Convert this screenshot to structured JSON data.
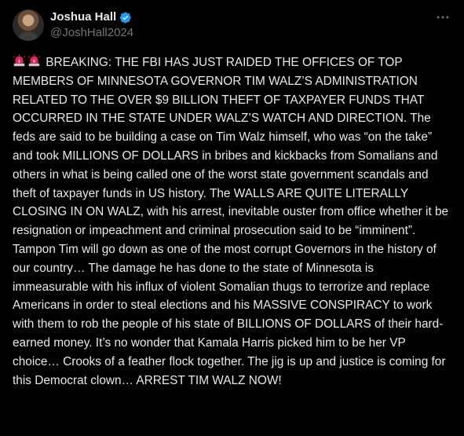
{
  "post": {
    "author": {
      "display_name": "Joshua Hall",
      "handle": "@JoshHall2024",
      "verified": true,
      "verified_color": "#1d9bf0"
    },
    "menu_icon": "more-horizontal-icon",
    "emoji_prefix": [
      "siren-emoji",
      "siren-emoji"
    ],
    "text": "BREAKING: THE FBI HAS JUST RAIDED THE OFFICES OF TOP MEMBERS OF MINNESOTA GOVERNOR TIM WALZ’S ADMINISTRATION RELATED TO THE OVER $9 BILLION THEFT OF TAXPAYER FUNDS THAT OCCURRED IN THE STATE UNDER WALZ’S WATCH AND DIRECTION. The feds are said to be building a case on Tim Walz himself, who was “on the take” and took MILLIONS OF DOLLARS in bribes and kickbacks from Somalians and others in what is being called one of the worst state government scandals and theft of taxpayer funds in US history. The WALLS ARE QUITE LITERALLY CLOSING IN ON WALZ, with his arrest, inevitable ouster from office whether it be resignation or impeachment and criminal prosecution said to be “imminent”. Tampon Tim will go down as one of the most corrupt Governors in the history of our country… The damage he has done to the state of Minnesota is immeasurable with his influx of violent Somalian thugs to terrorize and replace Americans in order to steal elections and his MASSIVE CONSPIRACY to work with them to rob the people of his state of BILLIONS OF DOLLARS of their hard-earned money. It’s no wonder that Kamala Harris picked him to be her VP choice… Crooks of a feather flock together. The jig is up and justice is coming for this Democrat clown… ARREST TIM WALZ NOW!"
  },
  "colors": {
    "background": "#000000",
    "primary_text": "#e7e9ea",
    "secondary_text": "#71767b",
    "accent": "#1d9bf0",
    "siren_red": "#e0245e"
  }
}
